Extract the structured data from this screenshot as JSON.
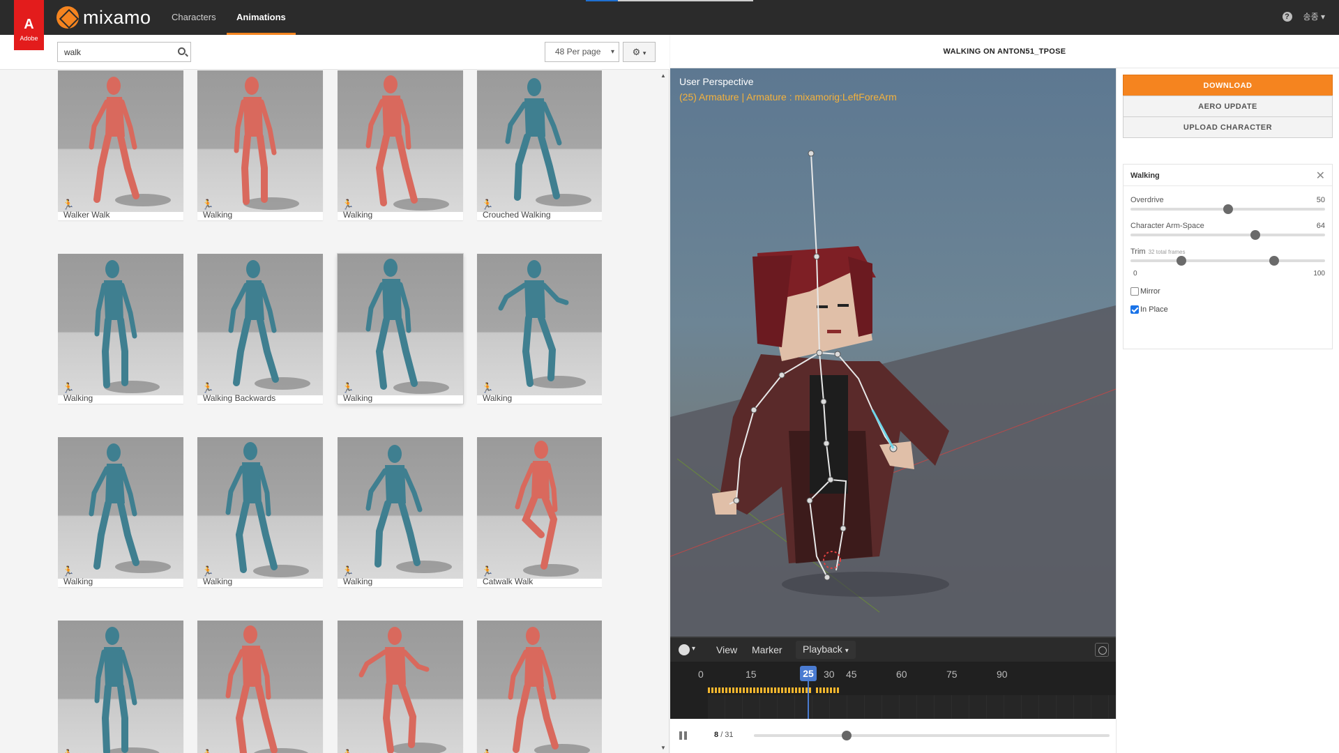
{
  "nav": {
    "adobe_glyph": "A",
    "adobe_label": "Adobe",
    "brand": "mixamo",
    "tabs": [
      {
        "label": "Characters",
        "active": false
      },
      {
        "label": "Animations",
        "active": true
      }
    ],
    "help_glyph": "?",
    "user_label": "송종"
  },
  "search": {
    "value": "walk",
    "placeholder": ""
  },
  "per_page": {
    "selected": "48 Per page"
  },
  "settings_icon": "gear-icon",
  "animations": [
    {
      "label": "Walker Walk",
      "color": "red",
      "pose": 0
    },
    {
      "label": "Walking",
      "color": "red",
      "pose": 1
    },
    {
      "label": "Walking",
      "color": "red",
      "pose": 2
    },
    {
      "label": "Crouched Walking",
      "color": "blue",
      "pose": 3
    },
    {
      "label": "Walking",
      "color": "blue",
      "pose": 1
    },
    {
      "label": "Walking Backwards",
      "color": "blue",
      "pose": 0
    },
    {
      "label": "Walking",
      "color": "blue",
      "pose": 2,
      "selected": true
    },
    {
      "label": "Walking",
      "color": "blue",
      "pose": 4
    },
    {
      "label": "Walking",
      "color": "blue",
      "pose": 0
    },
    {
      "label": "Walking",
      "color": "blue",
      "pose": 2
    },
    {
      "label": "Walking",
      "color": "blue",
      "pose": 3
    },
    {
      "label": "Catwalk Walk",
      "color": "red",
      "pose": 5
    },
    {
      "label": "",
      "color": "blue",
      "pose": 1
    },
    {
      "label": "",
      "color": "red",
      "pose": 2
    },
    {
      "label": "",
      "color": "red",
      "pose": 4
    },
    {
      "label": "",
      "color": "red",
      "pose": 0
    }
  ],
  "colors": {
    "red": "#d9695d",
    "blue": "#3f7f90",
    "accent": "#f5841f",
    "timeline_key": "#f2b62e",
    "timeline_cursor": "#4a7bd1"
  },
  "preview": {
    "title": "WALKING ON ANTON51_TPOSE",
    "viewport_title": "User Perspective",
    "viewport_subtitle": "(25) Armature | Armature : mixamorig:LeftForeArm"
  },
  "timeline": {
    "menu": [
      "View",
      "Marker"
    ],
    "playback_label": "Playback",
    "ticks": [
      "0",
      "15",
      "30",
      "45",
      "60",
      "75",
      "90"
    ],
    "current_frame": "25"
  },
  "playback": {
    "frame": "8",
    "total": "/ 31",
    "progress": 0.26
  },
  "actions": {
    "download": "DOWNLOAD",
    "aero_update": "AERO UPDATE",
    "upload_character": "UPLOAD CHARACTER"
  },
  "settings": {
    "title": "Walking",
    "params": [
      {
        "label": "Overdrive",
        "value": "50",
        "fraction": 0.5
      },
      {
        "label": "Character Arm-Space",
        "value": "64",
        "fraction": 0.64
      }
    ],
    "trim": {
      "label": "Trim",
      "hint": "32 total frames",
      "min": "0",
      "max": "100",
      "start": 0.26,
      "end": 0.74
    },
    "mirror": {
      "label": "Mirror",
      "checked": false
    },
    "in_place": {
      "label": "In Place",
      "checked": true
    }
  }
}
